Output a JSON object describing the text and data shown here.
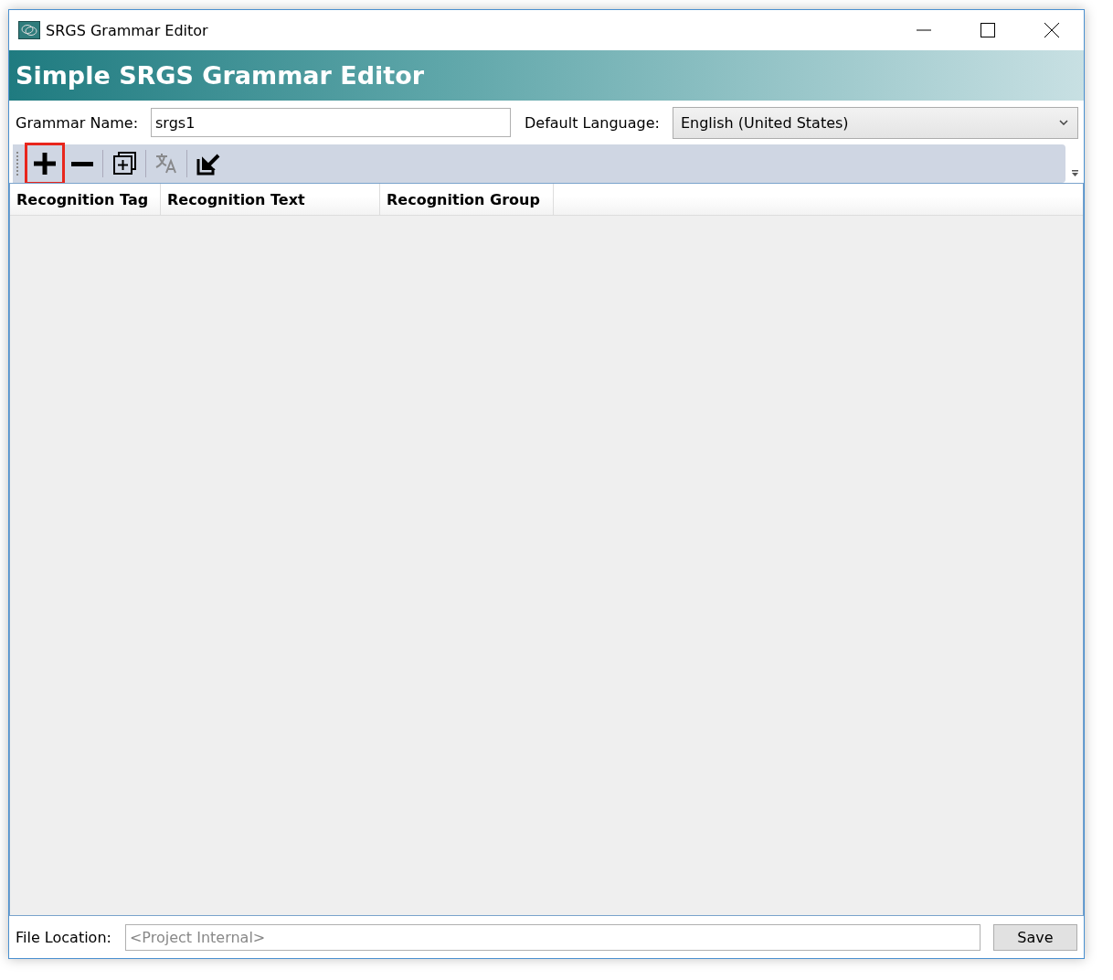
{
  "window": {
    "title": "SRGS Grammar Editor"
  },
  "banner": {
    "title": "Simple SRGS Grammar Editor"
  },
  "grammar_name": {
    "label": "Grammar Name:",
    "value": "srgs1"
  },
  "default_language": {
    "label": "Default Language:",
    "value": "English (United States)"
  },
  "toolbar": [
    {
      "kind": "plus",
      "highlighted": true,
      "disabled": false
    },
    {
      "kind": "minus",
      "highlighted": false,
      "disabled": false
    },
    {
      "kind": "duplicate",
      "highlighted": false,
      "disabled": false
    },
    {
      "kind": "translate",
      "highlighted": false,
      "disabled": true
    },
    {
      "kind": "export",
      "highlighted": false,
      "disabled": false
    }
  ],
  "table": {
    "columns": [
      "Recognition Tag",
      "Recognition Text",
      "Recognition Group"
    ]
  },
  "file_location": {
    "label": "File Location:",
    "placeholder": "<Project Internal>"
  },
  "save_button": "Save"
}
